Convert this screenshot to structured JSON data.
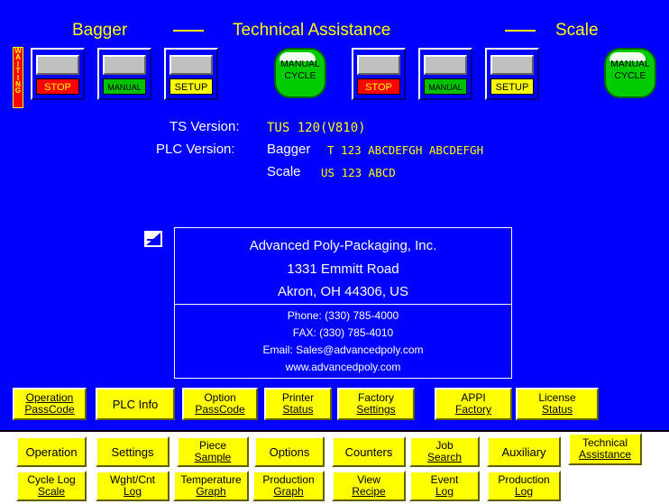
{
  "header": {
    "left_title": "Bagger",
    "center_title": "Technical Assistance",
    "right_title": "Scale"
  },
  "status": {
    "waiting_text": "WAITING"
  },
  "bagger_controls": {
    "stop_label": "STOP",
    "manual_label": "MANUAL",
    "setup_label": "SETUP",
    "manual_cycle_line1": "MANUAL",
    "manual_cycle_line2": "CYCLE"
  },
  "scale_controls": {
    "stop_label": "STOP",
    "manual_label": "MANUAL",
    "setup_label": "SETUP",
    "manual_cycle_line1": "MANUAL",
    "manual_cycle_line2": "CYCLE"
  },
  "versions": {
    "ts_label": "TS Version:",
    "ts_value": "TUS 120(V810)",
    "plc_label": "PLC Version:",
    "bagger_label": "Bagger",
    "bagger_value": "T  123 ABCDEFGH ABCDEFGH",
    "scale_label": "Scale",
    "scale_value": "US 123 ABCD"
  },
  "company": {
    "name": "Advanced Poly-Packaging, Inc.",
    "street": "1331 Emmitt Road",
    "city": "Akron, OH 44306, US",
    "phone": "Phone: (330) 785-4000",
    "fax": "FAX: (330) 785-4010",
    "email": "Email: Sales@advancedpoly.com",
    "web": "www.advancedpoly.com"
  },
  "ta_buttons": [
    {
      "line1": "Operation",
      "line2": "PassCode"
    },
    {
      "line1": "PLC Info",
      "line2": ""
    },
    {
      "line1": "Option",
      "line2": "PassCode"
    },
    {
      "line1": "Printer",
      "line2": "Status"
    },
    {
      "line1": "Factory",
      "line2": "Settings"
    },
    {
      "line1": "APPI",
      "line2": "Factory"
    },
    {
      "line1": "License",
      "line2": "Status"
    }
  ],
  "tabs_row1": [
    {
      "line1": "Operation",
      "line2": ""
    },
    {
      "line1": "Settings",
      "line2": ""
    },
    {
      "line1": "Piece",
      "line2": "Sample"
    },
    {
      "line1": "Options",
      "line2": ""
    },
    {
      "line1": "Counters",
      "line2": ""
    },
    {
      "line1": "Job",
      "line2": "Search"
    },
    {
      "line1": "Auxiliary",
      "line2": ""
    },
    {
      "line1": "Technical",
      "line2": "Assistance"
    }
  ],
  "tabs_row2": [
    {
      "line1": "Cycle Log",
      "line2": "Scale"
    },
    {
      "line1": "Wght/Cnt",
      "line2": "Log"
    },
    {
      "line1": "Temperature",
      "line2": "Graph"
    },
    {
      "line1": "Production",
      "line2": "Graph"
    },
    {
      "line1": "View",
      "line2": "Recipe"
    },
    {
      "line1": "Event",
      "line2": "Log"
    },
    {
      "line1": "Production",
      "line2": "Log"
    }
  ],
  "colors": {
    "background": "#0000ff",
    "accent_text": "#ffff00",
    "button": "#ffff00",
    "stop": "#ff0000",
    "manual": "#00c000"
  }
}
